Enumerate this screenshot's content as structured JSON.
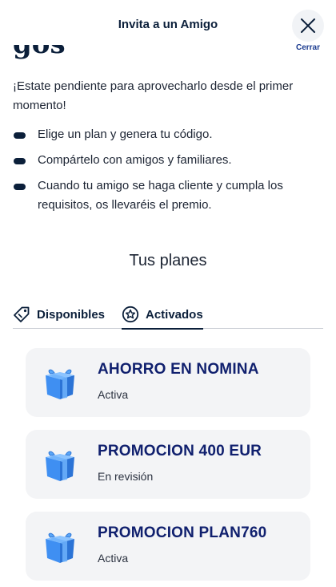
{
  "header": {
    "title": "Invita a un Amigo",
    "close_label": "Cerrar"
  },
  "content": {
    "partial_heading": "gos",
    "intro": "¡Estate pendiente para aprovecharlo desde el primer momento!",
    "steps": [
      "Elige un plan y genera tu código.",
      "Compártelo con amigos y familiares.",
      "Cuando tu amigo se haga cliente y cumpla los requisitos, os llevaréis el premio."
    ]
  },
  "plans": {
    "title": "Tus planes",
    "tabs": [
      {
        "label": "Disponibles",
        "icon": "tag-icon",
        "selected": false
      },
      {
        "label": "Activados",
        "icon": "star-badge-icon",
        "selected": true
      }
    ],
    "items": [
      {
        "name": "AHORRO EN NOMINA",
        "status": "Activa",
        "icon": "gift-icon"
      },
      {
        "name": "PROMOCION 400 EUR",
        "status": "En revisión",
        "icon": "gift-icon"
      },
      {
        "name": "PROMOCION PLAN760",
        "status": "Activa",
        "icon": "gift-icon"
      }
    ]
  },
  "colors": {
    "primary_text": "#0b1f3a",
    "plan_name": "#10206e",
    "card_bg": "#f3f4f6",
    "gift_blue": "#3d8cf0"
  }
}
